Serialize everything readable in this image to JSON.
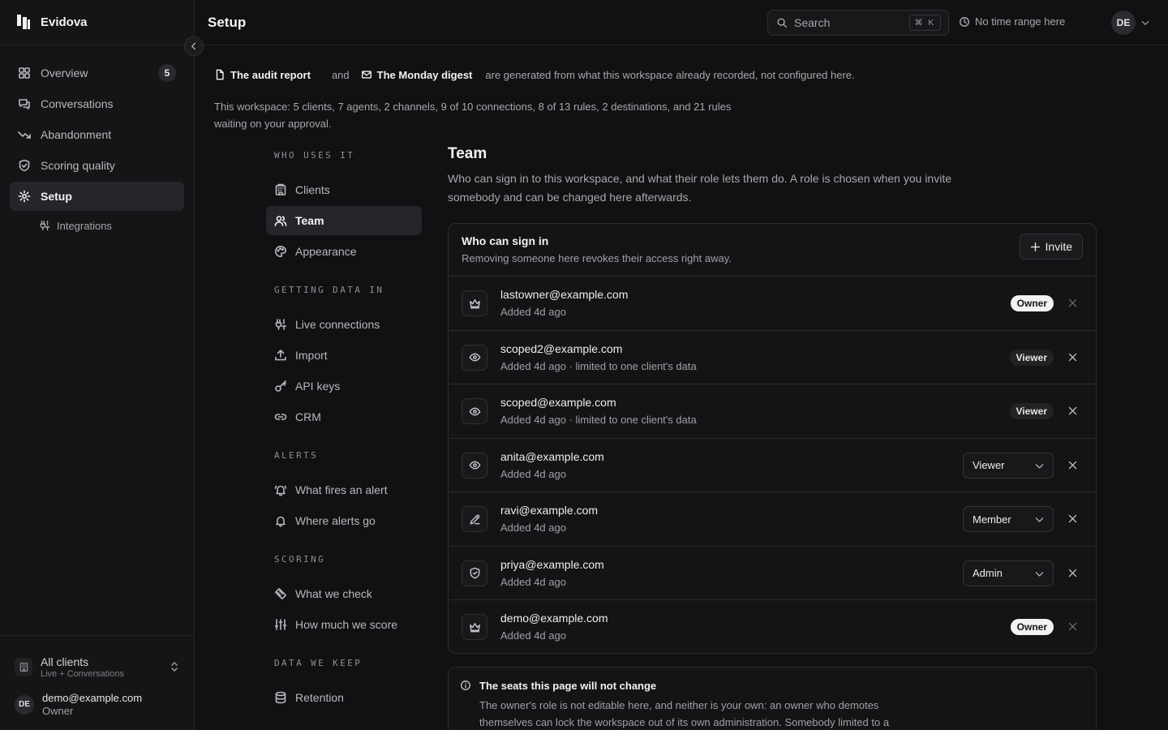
{
  "app": {
    "name": "Evidova"
  },
  "sidebar": {
    "items": [
      {
        "label": "Overview",
        "icon": "grid-icon",
        "badge": "5"
      },
      {
        "label": "Conversations",
        "icon": "chat-icon"
      },
      {
        "label": "Abandonment",
        "icon": "trend-down-icon"
      },
      {
        "label": "Scoring quality",
        "icon": "shield-check-icon"
      },
      {
        "label": "Setup",
        "icon": "gear-icon",
        "active": true
      }
    ],
    "sub_items": [
      {
        "label": "Integrations",
        "icon": "plug-icon"
      }
    ],
    "client_switcher": {
      "name": "All clients",
      "sub": "Live + Conversations"
    },
    "user": {
      "initials": "DE",
      "email": "demo@example.com",
      "role": "Owner"
    }
  },
  "topbar": {
    "title": "Setup",
    "search_label": "Search",
    "search_shortcut": "⌘ K",
    "time_range": "No time range here",
    "avatar_initials": "DE"
  },
  "intro": {
    "link1": "The audit report",
    "connector": "and",
    "link2": "The Monday digest",
    "rest": "are generated from what this workspace already recorded, not configured here.",
    "summary": "This workspace: 5 clients, 7 agents, 2 channels, 9 of 10 connections, 8 of 13 rules, 2 destinations, and 21 rules waiting on your approval."
  },
  "subnav": {
    "groups": [
      {
        "label": "WHO USES IT",
        "items": [
          {
            "label": "Clients",
            "icon": "building-icon"
          },
          {
            "label": "Team",
            "icon": "users-icon",
            "active": true
          },
          {
            "label": "Appearance",
            "icon": "palette-icon"
          }
        ]
      },
      {
        "label": "GETTING DATA IN",
        "items": [
          {
            "label": "Live connections",
            "icon": "plug-icon"
          },
          {
            "label": "Import",
            "icon": "upload-icon"
          },
          {
            "label": "API keys",
            "icon": "key-icon"
          },
          {
            "label": "CRM",
            "icon": "link-icon"
          }
        ]
      },
      {
        "label": "ALERTS",
        "items": [
          {
            "label": "What fires an alert",
            "icon": "bell-ring-icon"
          },
          {
            "label": "Where alerts go",
            "icon": "bell-icon"
          }
        ]
      },
      {
        "label": "SCORING",
        "items": [
          {
            "label": "What we check",
            "icon": "ruler-icon"
          },
          {
            "label": "How much we score",
            "icon": "sliders-icon"
          }
        ]
      },
      {
        "label": "DATA WE KEEP",
        "items": [
          {
            "label": "Retention",
            "icon": "database-icon"
          }
        ]
      }
    ]
  },
  "team": {
    "title": "Team",
    "description": "Who can sign in to this workspace, and what their role lets them do. A role is chosen when you invite somebody and can be changed here afterwards.",
    "card_title": "Who can sign in",
    "card_sub": "Removing someone here revokes their access right away.",
    "invite_label": "Invite",
    "members": [
      {
        "email": "lastowner@example.com",
        "meta": "Added 4d ago",
        "role": "Owner",
        "mode": "owner",
        "icon": "crown-icon"
      },
      {
        "email": "scoped2@example.com",
        "meta": "Added 4d ago · limited to one client's data",
        "role": "Viewer",
        "mode": "pill",
        "icon": "eye-icon"
      },
      {
        "email": "scoped@example.com",
        "meta": "Added 4d ago · limited to one client's data",
        "role": "Viewer",
        "mode": "pill",
        "icon": "eye-icon"
      },
      {
        "email": "anita@example.com",
        "meta": "Added 4d ago",
        "role": "Viewer",
        "mode": "select",
        "icon": "eye-icon"
      },
      {
        "email": "ravi@example.com",
        "meta": "Added 4d ago",
        "role": "Member",
        "mode": "select",
        "icon": "pencil-icon"
      },
      {
        "email": "priya@example.com",
        "meta": "Added 4d ago",
        "role": "Admin",
        "mode": "select",
        "icon": "shield-icon"
      },
      {
        "email": "demo@example.com",
        "meta": "Added 4d ago",
        "role": "Owner",
        "mode": "owner",
        "icon": "crown-icon"
      }
    ],
    "note_title": "The seats this page will not change",
    "note_body": "The owner's role is not editable here, and neither is your own: an owner who demotes themselves can lock the workspace out of its own administration. Somebody limited to a"
  }
}
